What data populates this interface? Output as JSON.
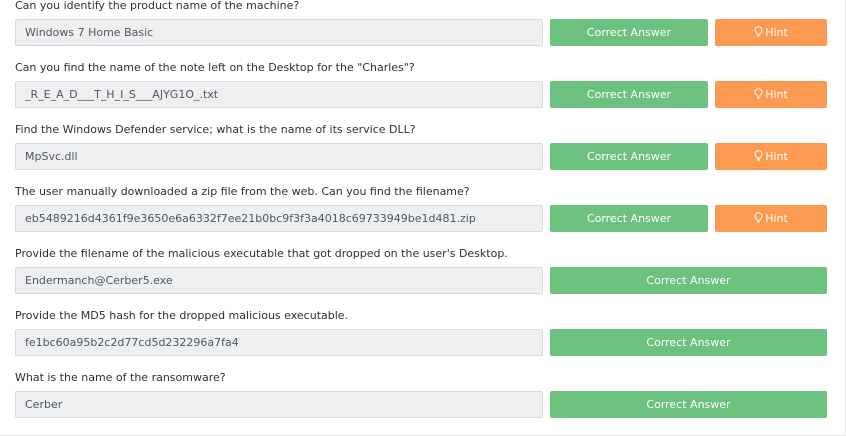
{
  "questions": [
    {
      "label": "Can you identify the product name of the machine?",
      "answer": "Windows 7 Home Basic",
      "correct_label": "Correct Answer",
      "hint_label": "Hint"
    },
    {
      "label": "Can you find the name of the note left on the Desktop for the \"Charles\"?",
      "answer": "_R_E_A_D___T_H_I_S___AJYG1O_.txt",
      "correct_label": "Correct Answer",
      "hint_label": "Hint"
    },
    {
      "label": "Find the Windows Defender service; what is the name of its service DLL?",
      "answer": "MpSvc.dll",
      "correct_label": "Correct Answer",
      "hint_label": "Hint"
    },
    {
      "label": "The user manually downloaded a zip file from the web. Can you find the filename?",
      "answer": "eb5489216d4361f9e3650e6a6332f7ee21b0bc9f3f3a4018c69733949be1d481.zip",
      "correct_label": "Correct Answer",
      "hint_label": "Hint"
    },
    {
      "label": "Provide the filename of the malicious executable that got dropped on the user's Desktop.",
      "answer": "Endermanch@Cerber5.exe",
      "correct_label": "Correct Answer"
    },
    {
      "label": "Provide the MD5 hash for the dropped malicious executable.",
      "answer": "fe1bc60a95b2c2d77cd5d232296a7fa4",
      "correct_label": "Correct Answer"
    },
    {
      "label": "What is the name of the ransomware?",
      "answer": "Cerber",
      "correct_label": "Correct Answer"
    }
  ],
  "colors": {
    "correct": "#6cc17f",
    "hint": "#fb9a50",
    "field_bg": "#edeff1"
  }
}
